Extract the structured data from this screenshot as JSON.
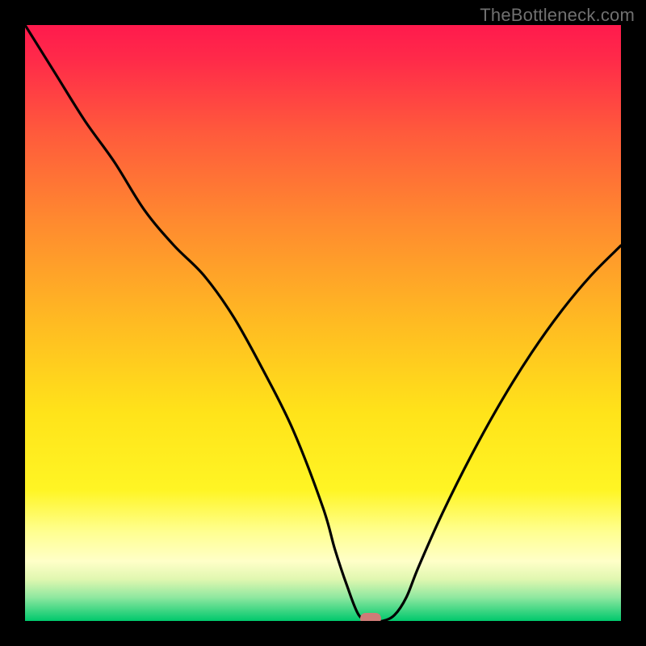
{
  "watermark": "TheBottleneck.com",
  "chart_data": {
    "type": "line",
    "title": "",
    "xlabel": "",
    "ylabel": "",
    "xlim": [
      0,
      100
    ],
    "ylim": [
      0,
      100
    ],
    "background": {
      "kind": "vertical-gradient",
      "stops": [
        {
          "offset": 0.0,
          "color": "#ff1a4d"
        },
        {
          "offset": 0.06,
          "color": "#ff2b49"
        },
        {
          "offset": 0.18,
          "color": "#ff5a3c"
        },
        {
          "offset": 0.33,
          "color": "#ff8a2f"
        },
        {
          "offset": 0.5,
          "color": "#ffbb22"
        },
        {
          "offset": 0.65,
          "color": "#ffe31a"
        },
        {
          "offset": 0.78,
          "color": "#fff524"
        },
        {
          "offset": 0.85,
          "color": "#ffff90"
        },
        {
          "offset": 0.9,
          "color": "#ffffc8"
        },
        {
          "offset": 0.93,
          "color": "#e0f7b0"
        },
        {
          "offset": 0.96,
          "color": "#90e8a0"
        },
        {
          "offset": 0.985,
          "color": "#35d480"
        },
        {
          "offset": 1.0,
          "color": "#00c86c"
        }
      ]
    },
    "series": [
      {
        "name": "bottleneck-curve",
        "color": "#000000",
        "x": [
          0,
          5,
          10,
          15,
          20,
          25,
          30,
          35,
          40,
          45,
          50,
          52,
          54,
          56,
          58,
          60,
          62,
          64,
          66,
          70,
          75,
          80,
          85,
          90,
          95,
          100
        ],
        "y": [
          100,
          92,
          84,
          77,
          69,
          63,
          58,
          51,
          42,
          32,
          19,
          12,
          6,
          1,
          0,
          0,
          1,
          4,
          9,
          18,
          28,
          37,
          45,
          52,
          58,
          63
        ]
      }
    ],
    "marker": {
      "x": 58,
      "y": 0,
      "color": "#cf7b77"
    },
    "grid": false,
    "legend": null
  }
}
